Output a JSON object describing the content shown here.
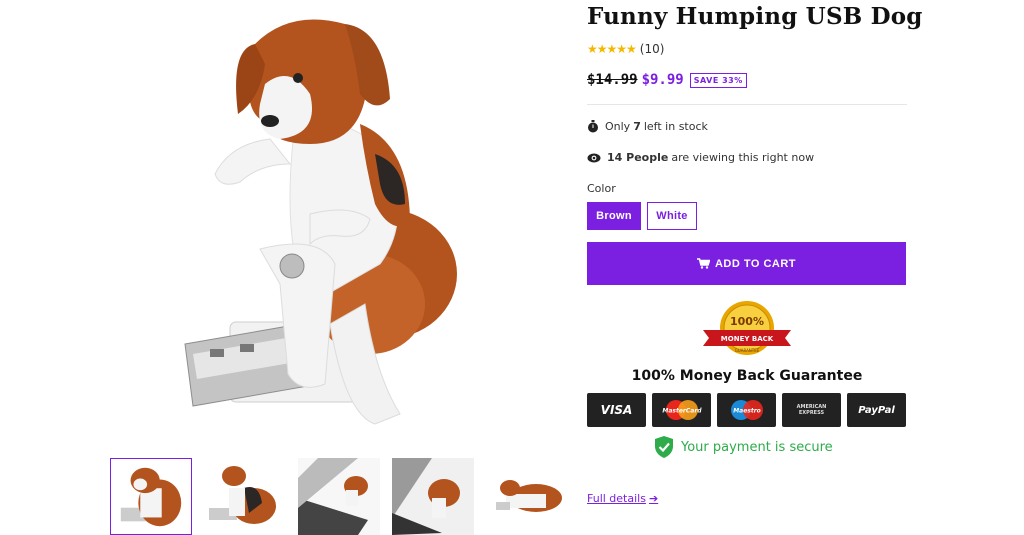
{
  "product": {
    "title": "Funny Humping USB Dog",
    "rating": {
      "stars": "★★★★★",
      "count": "(10)"
    },
    "old_price": "$14.99",
    "new_price": "$9.99",
    "save_badge": "SAVE 33%"
  },
  "stock": {
    "prefix": "Only",
    "count": "7",
    "suffix": "left in stock"
  },
  "viewers": {
    "count": "14 People",
    "suffix": "are viewing this right now"
  },
  "color": {
    "label": "Color",
    "options": [
      "Brown",
      "White"
    ],
    "selected": "Brown"
  },
  "cart": {
    "button_label": "ADD TO CART"
  },
  "guarantee": {
    "seal_top": "100%",
    "seal_ribbon": "MONEY BACK",
    "seal_bottom": "GUARANTEE",
    "title": "100% Money Back Guarantee"
  },
  "payment_cards": {
    "visa": "VISA",
    "mastercard": "MasterCard",
    "maestro": "Maestro",
    "amex_line1": "AMERICAN",
    "amex_line2": "EXPRESS",
    "paypal": "PayPal"
  },
  "secure": {
    "text": "Your payment is secure"
  },
  "links": {
    "full_details": "Full details",
    "arrow": "➔"
  },
  "icons": [
    "stopwatch-icon",
    "eye-icon",
    "cart-icon",
    "shield-check-icon",
    "arrow-right-icon"
  ],
  "colors": {
    "accent": "#7b1fe0",
    "secure_green": "#2eab4a",
    "star_gold": "#f5b800",
    "dog_brown": "#b3541e",
    "dog_black": "#2c2624",
    "dog_white": "#f4f4f4"
  }
}
